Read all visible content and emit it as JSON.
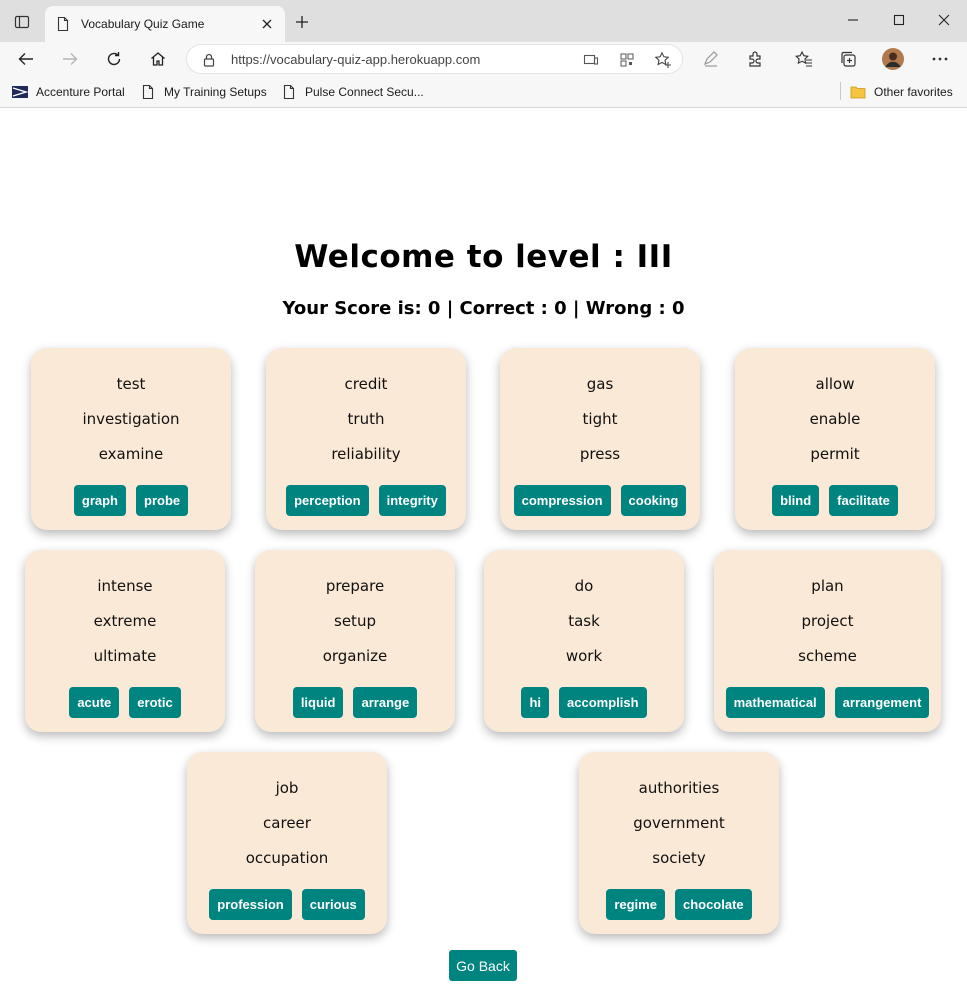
{
  "browser": {
    "tab_title": "Vocabulary Quiz Game",
    "url": "https://vocabulary-quiz-app.herokuapp.com",
    "bookmarks": [
      "Accenture Portal",
      "My Training Setups",
      "Pulse Connect Secu..."
    ],
    "other_favorites": "Other favorites"
  },
  "quiz": {
    "heading": "Welcome to level : III",
    "score_line": "Your Score is: 0 | Correct : 0 | Wrong : 0",
    "cards": [
      {
        "words": [
          "test",
          "investigation",
          "examine"
        ],
        "options": [
          "graph",
          "probe"
        ]
      },
      {
        "words": [
          "credit",
          "truth",
          "reliability"
        ],
        "options": [
          "perception",
          "integrity"
        ]
      },
      {
        "words": [
          "gas",
          "tight",
          "press"
        ],
        "options": [
          "compression",
          "cooking"
        ]
      },
      {
        "words": [
          "allow",
          "enable",
          "permit"
        ],
        "options": [
          "blind",
          "facilitate"
        ]
      },
      {
        "words": [
          "intense",
          "extreme",
          "ultimate"
        ],
        "options": [
          "acute",
          "erotic"
        ]
      },
      {
        "words": [
          "prepare",
          "setup",
          "organize"
        ],
        "options": [
          "liquid",
          "arrange"
        ]
      },
      {
        "words": [
          "do",
          "task",
          "work"
        ],
        "options": [
          "hi",
          "accomplish"
        ]
      },
      {
        "words": [
          "plan",
          "project",
          "scheme"
        ],
        "options": [
          "mathematical",
          "arrangement"
        ]
      },
      {
        "words": [
          "job",
          "career",
          "occupation"
        ],
        "options": [
          "profession",
          "curious"
        ]
      },
      {
        "words": [
          "authorities",
          "government",
          "society"
        ],
        "options": [
          "regime",
          "chocolate"
        ]
      }
    ],
    "go_back": "Go Back"
  },
  "colors": {
    "card_bg": "#fae9d6",
    "button": "#008480"
  }
}
